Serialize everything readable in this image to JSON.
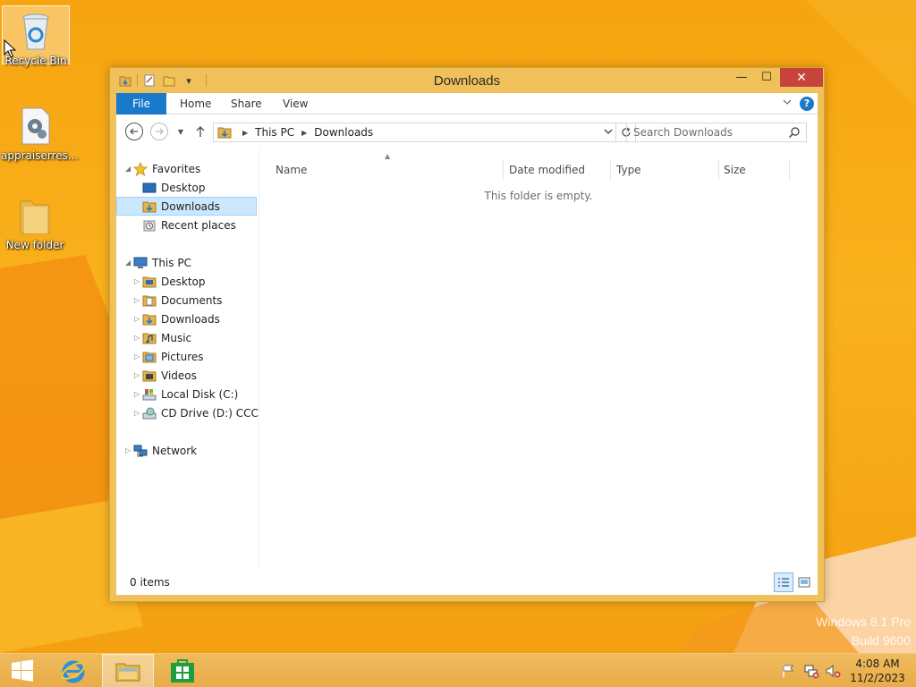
{
  "desktop": {
    "icons": [
      {
        "label": "Recycle Bin",
        "icon": "recycle-bin-icon"
      },
      {
        "label": "appraiserres...",
        "icon": "settings-file-icon"
      },
      {
        "label": "New folder",
        "icon": "folder-icon"
      }
    ],
    "watermark": {
      "line1": "Windows 8.1 Pro",
      "line2": "Build 9600"
    }
  },
  "window": {
    "title": "Downloads",
    "quick_access": [
      "properties-icon",
      "new-folder-icon",
      "customize-dropdown-icon"
    ],
    "controls": {
      "minimize": "—",
      "maximize": "☐",
      "close": "✕"
    },
    "ribbon": {
      "tabs": [
        {
          "label": "File",
          "active": true
        },
        {
          "label": "Home"
        },
        {
          "label": "Share"
        },
        {
          "label": "View"
        }
      ],
      "help": "?"
    },
    "navigation": {
      "breadcrumb": [
        "This PC",
        "Downloads"
      ],
      "search_placeholder": "Search Downloads"
    },
    "nav_pane": {
      "favorites": {
        "label": "Favorites",
        "items": [
          {
            "label": "Desktop",
            "icon": "desktop-icon"
          },
          {
            "label": "Downloads",
            "icon": "downloads-folder-icon",
            "selected": true
          },
          {
            "label": "Recent places",
            "icon": "recent-places-icon"
          }
        ]
      },
      "this_pc": {
        "label": "This PC",
        "items": [
          {
            "label": "Desktop",
            "icon": "desktop-folder-icon"
          },
          {
            "label": "Documents",
            "icon": "documents-folder-icon"
          },
          {
            "label": "Downloads",
            "icon": "downloads-folder-icon"
          },
          {
            "label": "Music",
            "icon": "music-folder-icon"
          },
          {
            "label": "Pictures",
            "icon": "pictures-folder-icon"
          },
          {
            "label": "Videos",
            "icon": "videos-folder-icon"
          },
          {
            "label": "Local Disk (C:)",
            "icon": "local-disk-icon"
          },
          {
            "label": "CD Drive (D:) CCCOI",
            "icon": "cd-drive-icon"
          }
        ]
      },
      "network": {
        "label": "Network"
      }
    },
    "columns": [
      "Name",
      "Date modified",
      "Type",
      "Size"
    ],
    "empty_message": "This folder is empty.",
    "status": {
      "count": "0 items"
    }
  },
  "taskbar": {
    "buttons": [
      "start-icon",
      "internet-explorer-icon",
      "file-explorer-icon",
      "store-icon"
    ],
    "tray": [
      "action-center-flag-icon",
      "network-icon",
      "volume-muted-icon"
    ],
    "clock": {
      "time": "4:08 AM",
      "date": "11/2/2023"
    }
  },
  "colors": {
    "accent_blue": "#1979ca",
    "window_frame": "#f0c15a",
    "close_red": "#c7443c",
    "desktop_orange": "#f6a40f",
    "selection": "#cce8ff"
  }
}
